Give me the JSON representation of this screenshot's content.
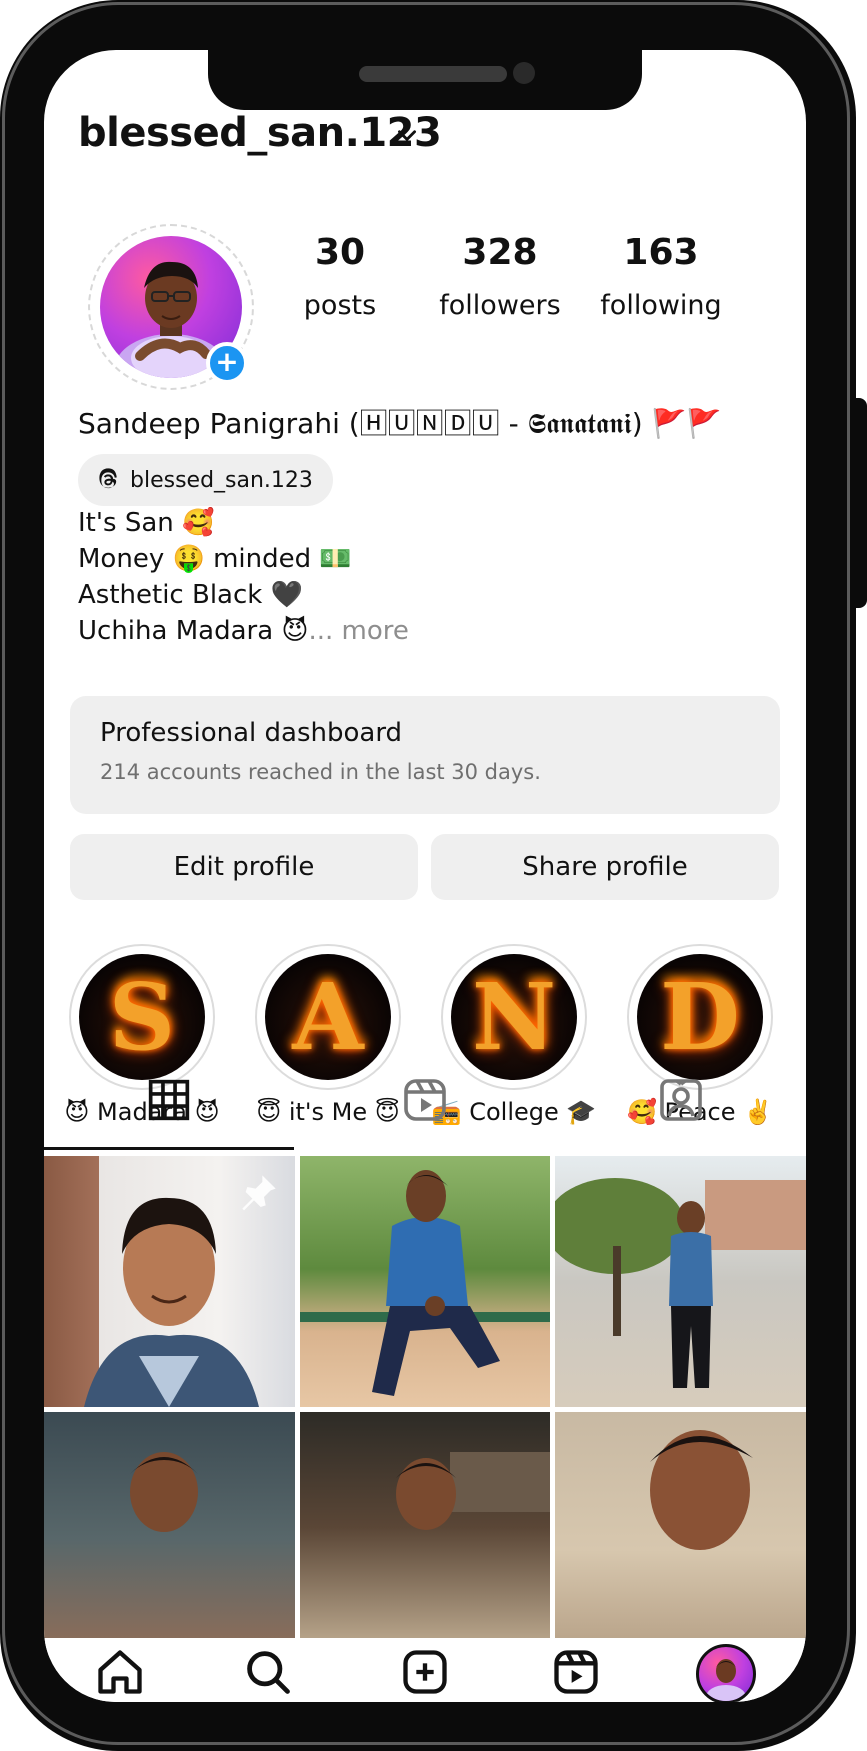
{
  "profile": {
    "username": "blessed_san.123",
    "full_name": "Sandeep Panigrahi (🄷🅄🄽🄳🅄 - 𝕾𝖆𝖓𝖆𝖙𝖆𝖓𝖎) 🚩🚩",
    "threads_handle": "blessed_san.123",
    "bio": [
      "It's San 🥰",
      "Money 🤑 minded 💵",
      "Asthetic Black 🖤",
      "Uchiha Madara 😈"
    ],
    "more": "... more"
  },
  "stats": {
    "posts": {
      "value": "30",
      "label": "posts"
    },
    "followers": {
      "value": "328",
      "label": "followers"
    },
    "following": {
      "value": "163",
      "label": "following"
    }
  },
  "dashboard": {
    "title": "Professional dashboard",
    "subtitle": "214 accounts reached in the last 30 days."
  },
  "buttons": {
    "edit": "Edit profile",
    "share": "Share profile"
  },
  "highlights": [
    {
      "letter": "S",
      "label": "😈 Madara 😈"
    },
    {
      "letter": "A",
      "label": "😇 it's Me 😇"
    },
    {
      "letter": "N",
      "label": "📻 College 🎓"
    },
    {
      "letter": "D",
      "label": "🥰 Peace ✌️"
    }
  ],
  "tabs": [
    "grid-icon",
    "reels-icon",
    "tagged-icon"
  ],
  "nav": [
    "home-icon",
    "search-icon",
    "create-icon",
    "reels-icon",
    "profile-avatar"
  ],
  "colors": {
    "accent": "#1b95f2",
    "surface": "#efefef",
    "text": "#111111",
    "muted": "#8e8e8e"
  }
}
